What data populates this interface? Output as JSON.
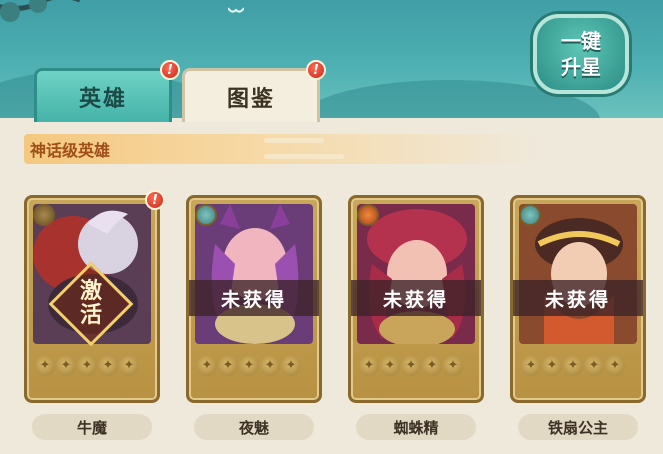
{
  "tabs": [
    {
      "label": "英雄",
      "badge": "!"
    },
    {
      "label": "图鉴",
      "badge": "!"
    }
  ],
  "upgrade_button": {
    "line1": "一键",
    "line2": "升星"
  },
  "tier": {
    "title": "神话级英雄"
  },
  "heroes": [
    {
      "name": "牛魔",
      "status": "激活",
      "activate_line1": "激",
      "activate_line2": "活",
      "badge": "!",
      "stars": 5,
      "element_icon": "earth-icon"
    },
    {
      "name": "夜魅",
      "status": "未获得",
      "stars": 5,
      "element_icon": "wind-icon"
    },
    {
      "name": "蜘蛛精",
      "status": "未获得",
      "stars": 5,
      "element_icon": "fire-icon"
    },
    {
      "name": "铁扇公主",
      "status": "未获得",
      "stars": 5,
      "element_icon": "wind-icon"
    }
  ],
  "colors": {
    "tab_active": "#45b3a8",
    "tier_text": "#a04f17",
    "card_gold": "#c9a75a",
    "badge_red": "#c8281c"
  }
}
